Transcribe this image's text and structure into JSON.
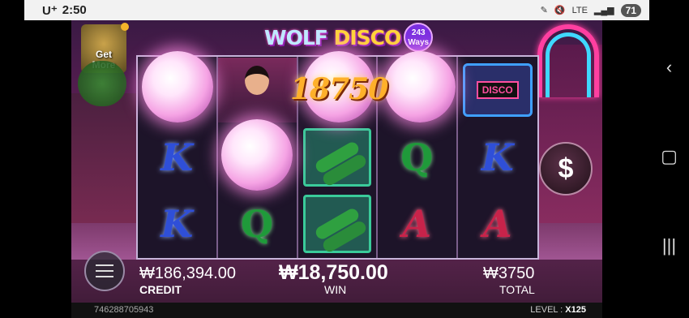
{
  "status_bar": {
    "carrier": "U⁺",
    "time": "2:50",
    "network": "LTE",
    "battery": "71"
  },
  "game": {
    "logo_title_w": "WOLF",
    "logo_title_d": "DISCO",
    "ways_number": "243",
    "ways_label": "Ways",
    "get_more_line1": "Get",
    "get_more_line2": "More",
    "win_amount_overlay": "18750",
    "reels": [
      [
        "disco-ball",
        "K",
        "K"
      ],
      [
        "woman",
        "disco-ball",
        "Q"
      ],
      [
        "disco-ball",
        "champagne",
        "champagne"
      ],
      [
        "disco-ball",
        "Q",
        "A"
      ],
      [
        "radio",
        "K",
        "A"
      ]
    ],
    "spin_symbol": "$"
  },
  "hud": {
    "credit_value": "₩186,394.00",
    "credit_label": "CREDIT",
    "win_value": "₩18,750.00",
    "win_label": "WIN",
    "total_value": "₩3750",
    "total_label": "TOTAL",
    "game_id": "746288705943",
    "level_label": "LEVEL :",
    "level_value": "X125"
  },
  "nav": {
    "back_icon": "back-icon",
    "home_icon": "home-icon",
    "recents_icon": "recents-icon"
  }
}
